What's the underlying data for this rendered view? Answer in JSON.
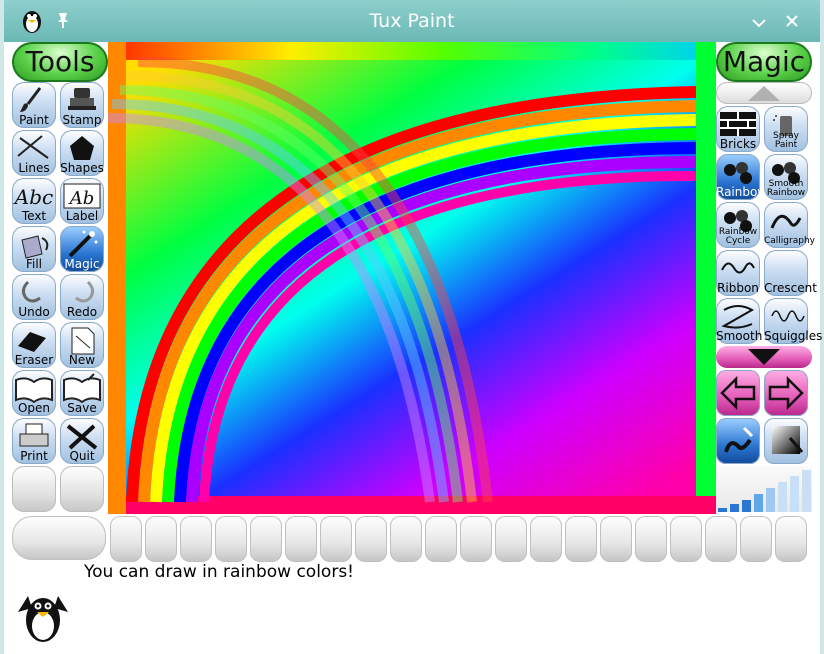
{
  "window": {
    "title": "Tux Paint"
  },
  "titlebar_icons": {
    "app": "tux-app-icon",
    "pin": "pin-icon",
    "minimize": "chevron-down-icon",
    "close": "close-icon"
  },
  "tools": {
    "header": "Tools",
    "items": [
      {
        "label": "Paint",
        "icon": "paintbrush-icon"
      },
      {
        "label": "Stamp",
        "icon": "stamp-icon"
      },
      {
        "label": "Lines",
        "icon": "lines-icon"
      },
      {
        "label": "Shapes",
        "icon": "pentagon-icon"
      },
      {
        "label": "Text",
        "icon": "text-icon"
      },
      {
        "label": "Label",
        "icon": "label-icon"
      },
      {
        "label": "Fill",
        "icon": "paint-bucket-icon"
      },
      {
        "label": "Magic",
        "icon": "magic-wand-icon",
        "selected": true
      },
      {
        "label": "Undo",
        "icon": "undo-icon"
      },
      {
        "label": "Redo",
        "icon": "redo-icon"
      },
      {
        "label": "Eraser",
        "icon": "eraser-icon"
      },
      {
        "label": "New",
        "icon": "new-page-icon"
      },
      {
        "label": "Open",
        "icon": "open-book-icon"
      },
      {
        "label": "Save",
        "icon": "save-book-icon"
      },
      {
        "label": "Print",
        "icon": "printer-icon"
      },
      {
        "label": "Quit",
        "icon": "quit-x-icon"
      }
    ]
  },
  "magic": {
    "header": "Magic",
    "items": [
      {
        "label": "Bricks",
        "icon": "bricks-icon"
      },
      {
        "label": "Spray Paint",
        "icon": "spray-paint-icon"
      },
      {
        "label": "Rainbow",
        "icon": "rainbow-icon",
        "selected": true
      },
      {
        "label": "Smooth Rainbow",
        "icon": "smooth-rainbow-icon"
      },
      {
        "label": "Rainbow Cycle",
        "icon": "rainbow-cycle-icon"
      },
      {
        "label": "Calligraphy",
        "icon": "calligraphy-icon"
      },
      {
        "label": "Ribbon",
        "icon": "ribbon-icon"
      },
      {
        "label": "Crescent",
        "icon": "crescent-icon"
      },
      {
        "label": "Smooth",
        "icon": "smooth-icon"
      },
      {
        "label": "Squiggles",
        "icon": "squiggles-icon"
      }
    ]
  },
  "status": {
    "message": "You can draw in rainbow colors!"
  },
  "colors": {
    "brand_titlebar": "#7cc6c3",
    "tools_green": "#5bd24a",
    "selected_blue": "#2a76d2",
    "nav_magenta": "#e35bb8"
  }
}
